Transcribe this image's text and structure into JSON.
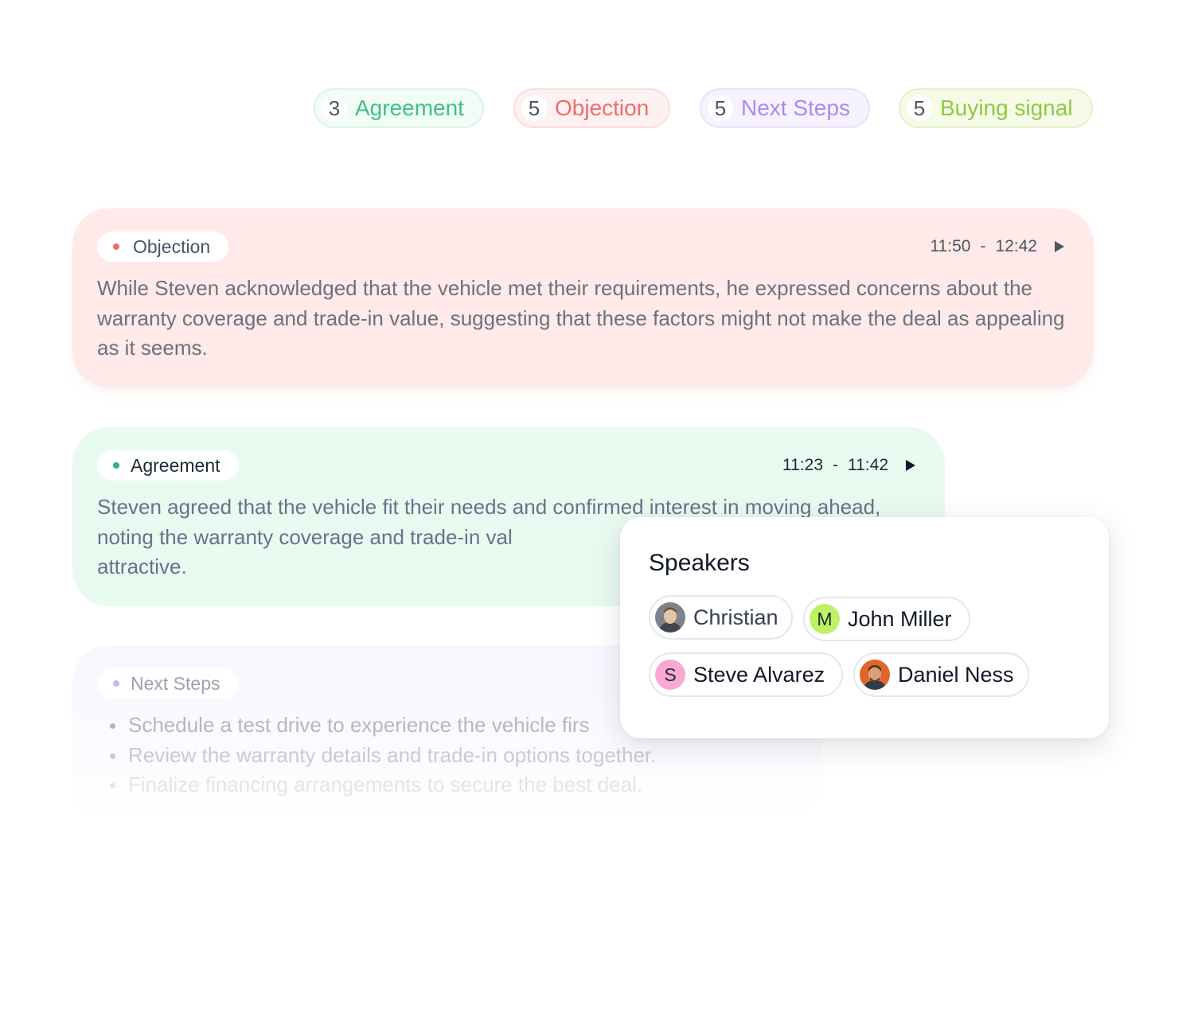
{
  "filters": [
    {
      "count": "3",
      "label": "Agreement"
    },
    {
      "count": "5",
      "label": "Objection"
    },
    {
      "count": "5",
      "label": "Next Steps"
    },
    {
      "count": "5",
      "label": "Buying signal"
    }
  ],
  "cards": {
    "objection": {
      "tag": "Objection",
      "start": "11:50",
      "separator": "-",
      "end": "12:42",
      "text": "While Steven acknowledged that the vehicle met their requirements, he expressed concerns about the warranty coverage and trade-in value, suggesting that these factors might not make the deal as appealing as it seems.",
      "color": "#f26b6b"
    },
    "agreement": {
      "tag": "Agreement",
      "start": "11:23",
      "separator": "-",
      "end": "11:42",
      "text": "Steven agreed that the vehicle fit their needs and confirmed interest in moving ahead, noting the warranty coverage and trade-in val",
      "text_end": "attractive.",
      "color": "#2bb673"
    },
    "nextsteps": {
      "tag": "Next Steps",
      "color": "#c4b5fd",
      "items": [
        "Schedule a test drive to experience the vehicle firs",
        "Review the warranty details and trade-in options together.",
        "Finalize financing arrangements to secure the best deal."
      ]
    }
  },
  "speakers": {
    "title": "Speakers",
    "list": [
      {
        "name": "Christian",
        "avatar": "photo-avatar"
      },
      {
        "name": "John Miller",
        "initial": "M",
        "color": "#bef264"
      },
      {
        "name": "Steve Alvarez",
        "initial": "S",
        "color": "#f9a8d4"
      },
      {
        "name": "Daniel Ness",
        "avatar": "photo-avatar"
      }
    ]
  }
}
